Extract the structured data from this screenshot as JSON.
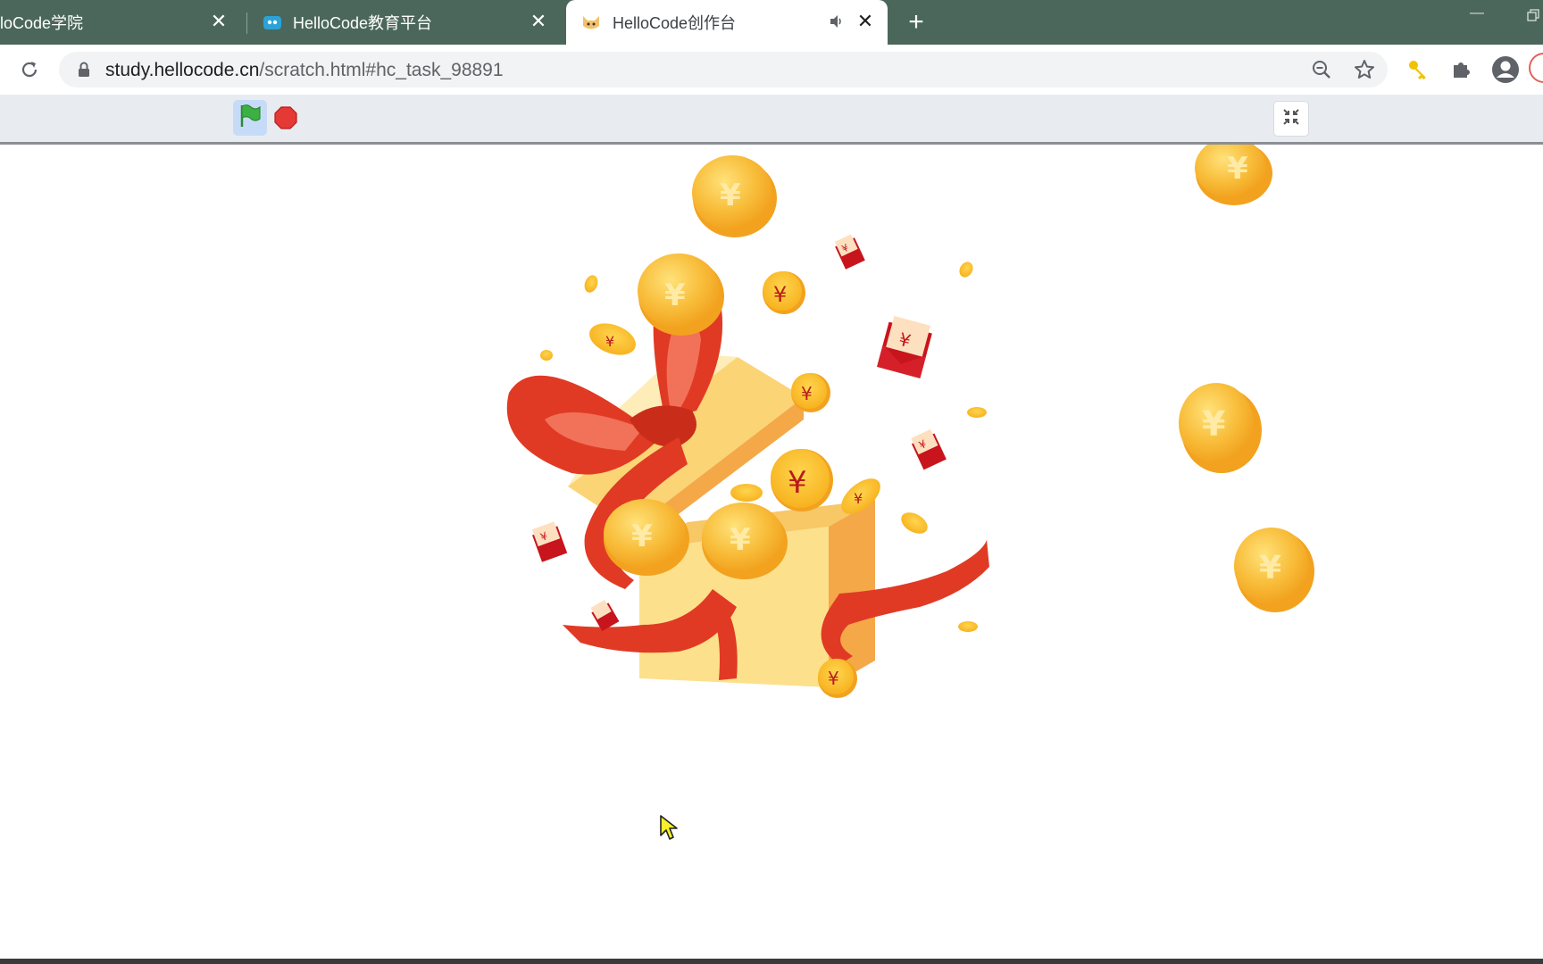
{
  "tabs": [
    {
      "title": "loCode学院",
      "active": false
    },
    {
      "title": "HelloCode教育平台",
      "active": false
    },
    {
      "title": "HelloCode创作台",
      "active": true
    }
  ],
  "address": {
    "host": "study.hellocode.cn",
    "path": "/scratch.html#hc_task_98891"
  },
  "icons": {
    "reload": "reload-icon",
    "lock": "lock-icon",
    "zoom": "zoom-out-icon",
    "star": "bookmark-star-icon",
    "key": "key-icon",
    "extensions": "puzzle-icon",
    "profile": "profile-icon",
    "flag": "green-flag-icon",
    "stop": "stop-icon",
    "fullscreen": "exit-fullscreen-icon",
    "audio": "speaker-icon"
  },
  "colors": {
    "tab_strip": "#4b675b",
    "flag": "#3cb043",
    "stop": "#e53935",
    "coin": "#f7b733",
    "ribbon": "#e03a25",
    "box": "#fde08b"
  }
}
